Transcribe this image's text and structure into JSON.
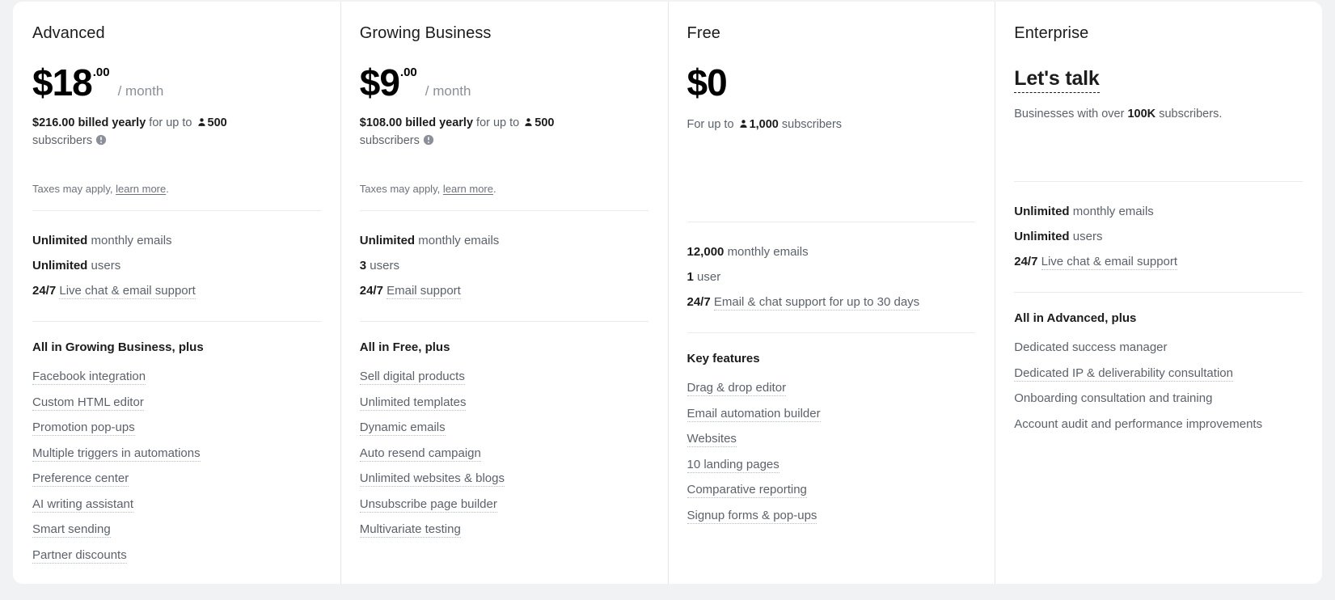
{
  "page": {
    "background_color": "#f1f2f4",
    "card_background": "#ffffff",
    "divider_color": "#e4e6e9"
  },
  "icons": {
    "person": "person-icon",
    "info": "info-icon"
  },
  "plans": [
    {
      "name": "Advanced",
      "price_main": "$18",
      "price_cents": ".00",
      "price_period": "/ month",
      "billing_amount": "$216.00 billed yearly",
      "billing_for_up_to": "for up to",
      "billing_subscribers_count": "500",
      "billing_subscribers_label": "subscribers",
      "taxes_prefix": "Taxes may apply,",
      "taxes_link": "learn more",
      "taxes_suffix": ".",
      "limits": [
        {
          "lead": "Unlimited",
          "rest": "monthly emails",
          "dotted": false
        },
        {
          "lead": "Unlimited",
          "rest": "users",
          "dotted": false
        },
        {
          "lead": "24/7",
          "rest": "Live chat & email support",
          "dotted": true
        }
      ],
      "features_title": "All in Growing Business, plus",
      "features": [
        {
          "label": "Facebook integration",
          "dotted": true
        },
        {
          "label": "Custom HTML editor",
          "dotted": true
        },
        {
          "label": "Promotion pop-ups",
          "dotted": true
        },
        {
          "label": "Multiple triggers in automations",
          "dotted": true
        },
        {
          "label": "Preference center",
          "dotted": true
        },
        {
          "label": "AI writing assistant",
          "dotted": true
        },
        {
          "label": "Smart sending",
          "dotted": true
        },
        {
          "label": "Partner discounts",
          "dotted": true
        }
      ]
    },
    {
      "name": "Growing Business",
      "price_main": "$9",
      "price_cents": ".00",
      "price_period": "/ month",
      "billing_amount": "$108.00 billed yearly",
      "billing_for_up_to": "for up to",
      "billing_subscribers_count": "500",
      "billing_subscribers_label": "subscribers",
      "taxes_prefix": "Taxes may apply,",
      "taxes_link": "learn more",
      "taxes_suffix": ".",
      "limits": [
        {
          "lead": "Unlimited",
          "rest": "monthly emails",
          "dotted": false
        },
        {
          "lead": "3",
          "rest": "users",
          "dotted": false
        },
        {
          "lead": "24/7",
          "rest": "Email support",
          "dotted": true
        }
      ],
      "features_title": "All in Free, plus",
      "features": [
        {
          "label": "Sell digital products",
          "dotted": true
        },
        {
          "label": "Unlimited templates",
          "dotted": true
        },
        {
          "label": "Dynamic emails",
          "dotted": true
        },
        {
          "label": "Auto resend campaign",
          "dotted": true
        },
        {
          "label": "Unlimited websites & blogs",
          "dotted": true
        },
        {
          "label": "Unsubscribe page builder",
          "dotted": true
        },
        {
          "label": "Multivariate testing",
          "dotted": true
        }
      ]
    },
    {
      "name": "Free",
      "price_main": "$0",
      "price_cents": "",
      "price_period": "",
      "sub_prefix": "For up to",
      "sub_count": "1,000",
      "sub_label": "subscribers",
      "limits": [
        {
          "lead": "12,000",
          "rest": "monthly emails",
          "dotted": false
        },
        {
          "lead": "1",
          "rest": "user",
          "dotted": false
        },
        {
          "lead": "24/7",
          "rest": "Email & chat support for up to 30 days",
          "dotted": true
        }
      ],
      "features_title": "Key features",
      "features": [
        {
          "label": "Drag & drop editor",
          "dotted": true
        },
        {
          "label": "Email automation builder",
          "dotted": true
        },
        {
          "label": "Websites",
          "dotted": true
        },
        {
          "label": "10 landing pages",
          "dotted": true
        },
        {
          "label": "Comparative reporting",
          "dotted": true
        },
        {
          "label": "Signup forms & pop-ups",
          "dotted": true
        }
      ]
    },
    {
      "name": "Enterprise",
      "cta_text": "Let's talk",
      "sub_prefix": "Businesses with over",
      "sub_count": "100K",
      "sub_label": "subscribers.",
      "limits": [
        {
          "lead": "Unlimited",
          "rest": "monthly emails",
          "dotted": false
        },
        {
          "lead": "Unlimited",
          "rest": "users",
          "dotted": false
        },
        {
          "lead": "24/7",
          "rest": "Live chat & email support",
          "dotted": true
        }
      ],
      "features_title": "All in Advanced, plus",
      "features": [
        {
          "label": "Dedicated success manager",
          "dotted": false
        },
        {
          "label": "Dedicated IP & deliverability consultation",
          "dotted": true
        },
        {
          "label": "Onboarding consultation and training",
          "dotted": false
        },
        {
          "label": "Account audit and performance improvements",
          "dotted": false
        }
      ]
    }
  ]
}
